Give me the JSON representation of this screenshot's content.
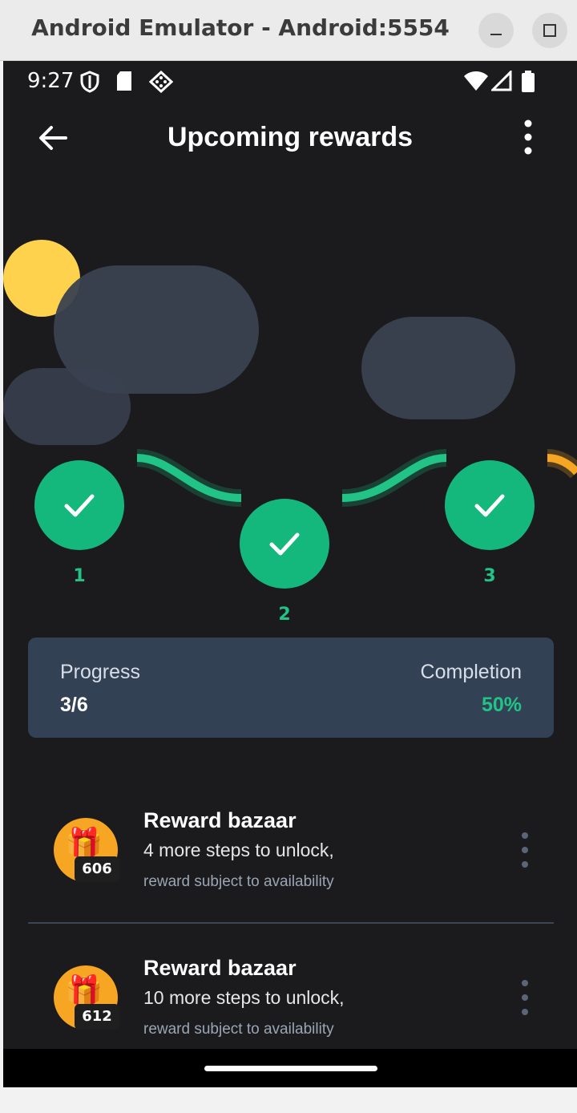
{
  "window": {
    "title": "Android Emulator - Android:5554"
  },
  "status_bar": {
    "time": "9:27",
    "icons_left": [
      "shield-icon",
      "sd-card-icon",
      "game-controller-icon"
    ],
    "icons_right": [
      "wifi-icon",
      "signal-icon",
      "battery-icon"
    ]
  },
  "app_bar": {
    "title": "Upcoming rewards"
  },
  "steps": [
    {
      "label": "1",
      "completed": true
    },
    {
      "label": "2",
      "completed": true
    },
    {
      "label": "3",
      "completed": true
    }
  ],
  "progress_card": {
    "progress_label": "Progress",
    "progress_value": "3/6",
    "completion_label": "Completion",
    "completion_value": "50%"
  },
  "rewards": [
    {
      "badge": "606",
      "title": "Reward bazaar",
      "subtitle": "4 more steps to unlock,",
      "note": "reward subject to availability"
    },
    {
      "badge": "612",
      "title": "Reward bazaar",
      "subtitle": "10 more steps to unlock,",
      "note": "reward subject to availability"
    }
  ],
  "colors": {
    "accent_green": "#14b87c",
    "card_bg": "#334155",
    "sun_yellow": "#ffd24d",
    "gift_orange": "#f6a623",
    "screen_bg": "#1b1b1d"
  }
}
